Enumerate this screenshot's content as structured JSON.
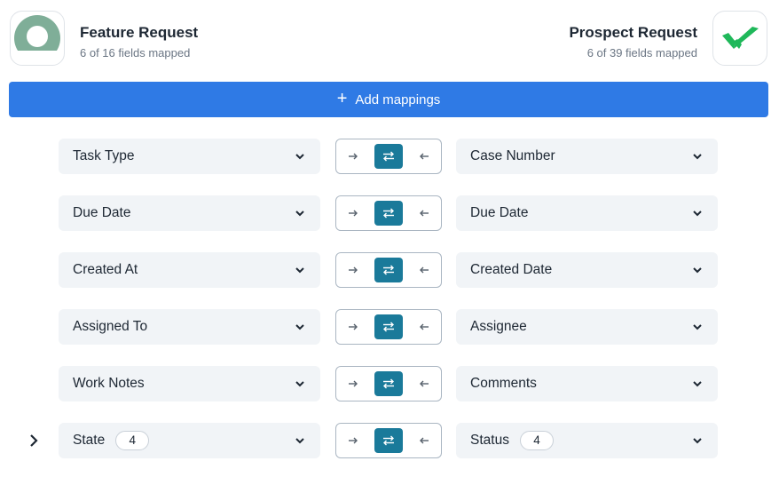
{
  "source_app": {
    "title": "Feature Request",
    "subtitle": "6 of 16 fields mapped",
    "logo_icon": "circle-avatar-icon",
    "logo_color": "#7fae98"
  },
  "target_app": {
    "title": "Prospect Request",
    "subtitle": "6 of 39 fields mapped",
    "logo_icon": "double-check-icon",
    "logo_color": "#1fb85a"
  },
  "add_button": {
    "label": "Add mappings",
    "icon": "plus-icon",
    "color": "#2f7ae5"
  },
  "accent_color": "#1a7a9a",
  "mappings": [
    {
      "left": "Task Type",
      "right": "Case Number",
      "direction": "both"
    },
    {
      "left": "Due Date",
      "right": "Due Date",
      "direction": "both"
    },
    {
      "left": "Created At",
      "right": "Created Date",
      "direction": "both"
    },
    {
      "left": "Assigned To",
      "right": "Assignee",
      "direction": "both"
    },
    {
      "left": "Work Notes",
      "right": "Comments",
      "direction": "both"
    },
    {
      "left": "State",
      "left_badge": "4",
      "right": "Status",
      "right_badge": "4",
      "direction": "both",
      "expandable": true
    }
  ]
}
